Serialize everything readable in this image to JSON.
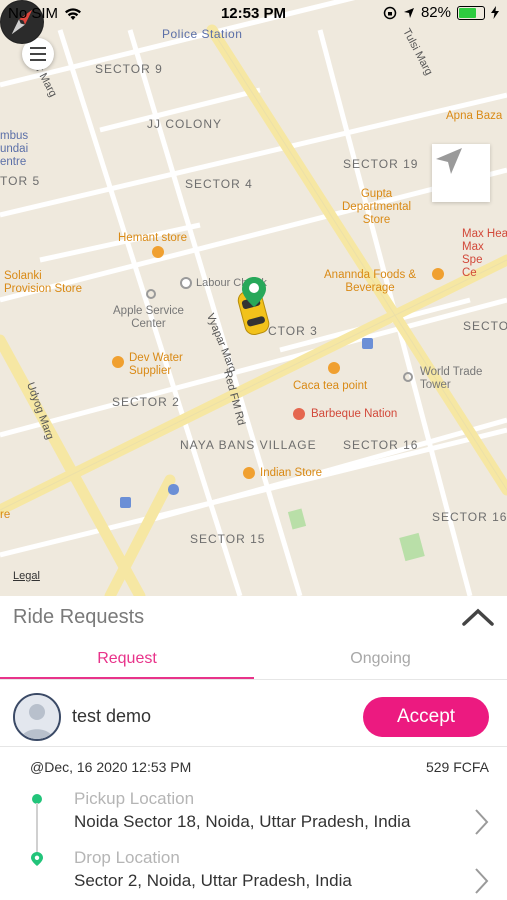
{
  "status_bar": {
    "carrier": "No SIM",
    "time": "12:53 PM",
    "battery_percent": "82%",
    "battery_level": 0.82
  },
  "map": {
    "labels": {
      "police_station": "Police Station",
      "sector_9": "SECTOR 9",
      "jj_colony": "JJ COLONY",
      "sector_19": "SECTOR 19",
      "sector_4": "SECTOR 4",
      "sector_5": "TOR 5",
      "sector_3": "CTOR 3",
      "sector_2": "SECTOR 2",
      "naya_bans": "NAYA BANS VILLAGE",
      "sector_16": "SECTOR 16",
      "sector_16b": "SECTOR 16",
      "sector_15": "SECTOR 15",
      "secto": "SECTO"
    },
    "roads": {
      "tulsi_marg": "Tulsi Marg",
      "dar_marg": "Dar Marg",
      "vyapar_marg": "Vyapar Marg",
      "udyog_marg": "Udyog Marg",
      "red_fm_rd": "Red FM Rd",
      "labour_chowk": "Labour Chowk"
    },
    "pois": {
      "apna_bazar": "Apna Baza",
      "mbus": "mbus\nundai\nentre",
      "gupta": "Gupta\nDepartmental\nStore",
      "max": "Max Hea\nMax\nSpe\nCe",
      "hemant": "Hemant store",
      "solanki": "Solanki\nProvision Store",
      "apple": "Apple Service\nCenter",
      "anannda": "Anannda Foods &\nBeverage",
      "dev_water": "Dev Water\nSupplier",
      "caca": "Caca tea point",
      "world_trade": "World Trade\nTower",
      "barbeque": "Barbeque Nation",
      "indian_store": "Indian Store",
      "re": "re"
    },
    "legal": "Legal"
  },
  "panel": {
    "title": "Ride Requests",
    "tabs": [
      {
        "label": "Request",
        "active": true
      },
      {
        "label": "Ongoing",
        "active": false
      }
    ],
    "request": {
      "user_name": "test demo",
      "accept_label": "Accept",
      "datetime": "@Dec, 16 2020 12:53 PM",
      "fare": "529 FCFA",
      "pickup_label": "Pickup Location",
      "pickup_value": "Noida Sector 18, Noida, Uttar Pradesh, India",
      "drop_label": "Drop Location",
      "drop_value": "Sector 2, Noida, Uttar Pradesh, India"
    }
  },
  "colors": {
    "accent_pink": "#ec1a80",
    "tab_active": "#e8338a",
    "route_green": "#22c47a",
    "map_bg": "#efe9dd",
    "road_yellow": "#f6e7a3"
  },
  "icons": [
    "wifi-icon",
    "location-arrow-icon",
    "lock-rotation-icon",
    "battery-icon",
    "charging-icon",
    "menu-icon",
    "compass-icon",
    "locate-me-icon",
    "car-icon",
    "driver-pin-icon",
    "chevron-up-icon",
    "user-avatar-icon",
    "chevron-right-icon"
  ]
}
